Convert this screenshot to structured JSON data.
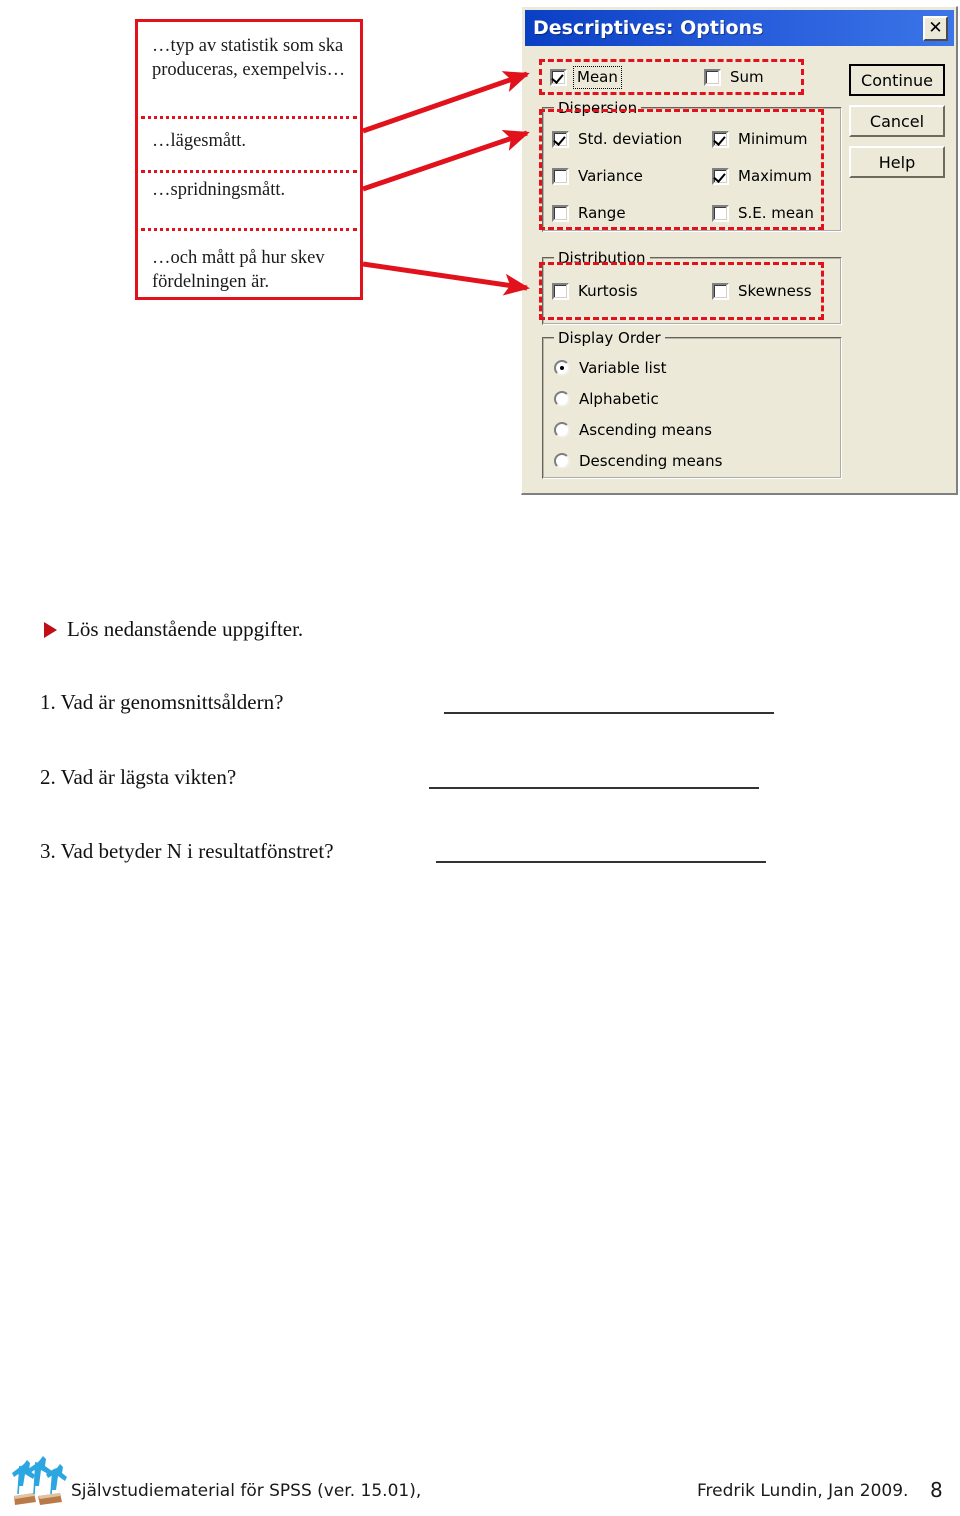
{
  "callout": {
    "segments": [
      "…typ av statistik som ska produceras, exempelvis…",
      "…lägesmått.",
      "…spridningsmått.",
      "…och mått på hur skev fördelningen är."
    ]
  },
  "dialog": {
    "title": "Descriptives: Options",
    "close_icon": "close-icon",
    "checkboxes": {
      "mean": {
        "label": "Mean",
        "checked": true
      },
      "sum": {
        "label": "Sum",
        "checked": false
      },
      "std_deviation": {
        "label": "Std. deviation",
        "checked": true
      },
      "minimum": {
        "label": "Minimum",
        "checked": true
      },
      "variance": {
        "label": "Variance",
        "checked": false
      },
      "maximum": {
        "label": "Maximum",
        "checked": true
      },
      "range": {
        "label": "Range",
        "checked": false
      },
      "se_mean": {
        "label": "S.E. mean",
        "checked": false
      },
      "kurtosis": {
        "label": "Kurtosis",
        "checked": false
      },
      "skewness": {
        "label": "Skewness",
        "checked": false
      }
    },
    "groups": {
      "dispersion": "Dispersion",
      "distribution": "Distribution",
      "display_order": "Display Order"
    },
    "display_order_options": [
      {
        "label": "Variable list",
        "selected": true
      },
      {
        "label": "Alphabetic",
        "selected": false
      },
      {
        "label": "Ascending means",
        "selected": false
      },
      {
        "label": "Descending means",
        "selected": false
      }
    ],
    "buttons": {
      "continue": "Continue",
      "cancel": "Cancel",
      "help": "Help"
    }
  },
  "exercise": {
    "heading": "Lös nedanstående uppgifter.",
    "questions": [
      "1. Vad är genomsnittsåldern?",
      "2. Vad är lägsta vikten?",
      "3. Vad betyder N i resultatfönstret?"
    ]
  },
  "footer": {
    "left": "Självstudiematerial för SPSS (ver. 15.01),",
    "right": "Fredrik Lundin, Jan 2009.",
    "page_number": "8"
  },
  "colors": {
    "annotation_red": "#e1121c",
    "titlebar_blue": "#0a3fc4",
    "dialog_face": "#ece9d8",
    "bullet_red": "#c00d16"
  }
}
